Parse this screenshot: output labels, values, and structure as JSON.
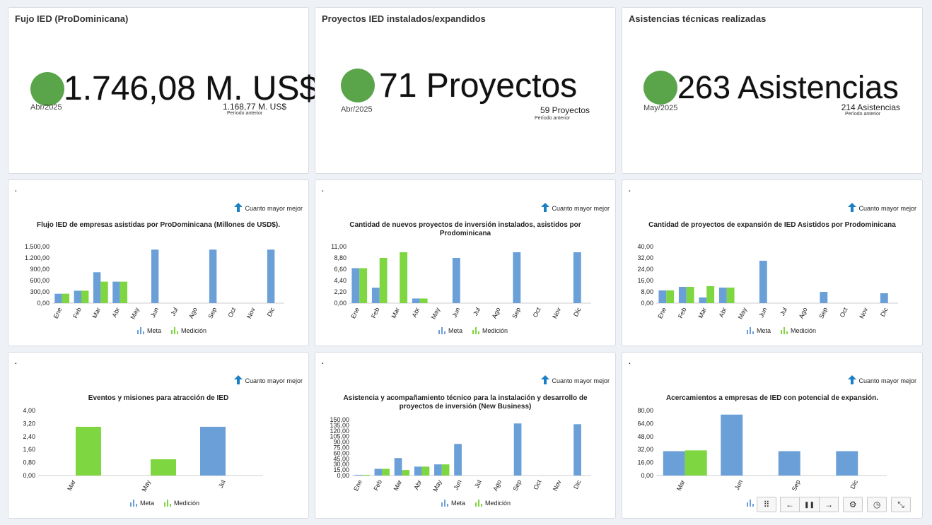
{
  "kpis": [
    {
      "title": "Fujo IED (ProDominicana)",
      "value": "1.746,08 M. US$",
      "date": "Abr/2025",
      "prev": "1.168,77 M. US$",
      "prev_label": "Período anterior",
      "color": "#5aa44a"
    },
    {
      "title": "Proyectos IED instalados/expandidos",
      "value": "71 Proyectos",
      "date": "Abr/2025",
      "prev": "59 Proyectos",
      "prev_label": "Período anterior",
      "color": "#5aa44a"
    },
    {
      "title": "Asistencias técnicas realizadas",
      "value": "263 Asistencias",
      "date": "May/2025",
      "prev": "214 Asistencias",
      "prev_label": "Período anterior",
      "color": "#5aa44a"
    }
  ],
  "common": {
    "dot": ".",
    "better": "Cuanto mayor mejor",
    "legend_meta": "Meta",
    "legend_medicion": "Medición",
    "colors": {
      "meta": "#6a9fd8",
      "medicion": "#7ed640",
      "up_arrow": "#1b7fc4"
    }
  },
  "chart_data": [
    {
      "type": "bar",
      "title": "Flujo IED de empresas asistidas por ProDominicana (Millones de USD$).",
      "categories": [
        "Ene",
        "Feb",
        "Mar",
        "Abr",
        "May",
        "Jun",
        "Jul",
        "Ago",
        "Sep",
        "Oct",
        "Nov",
        "Dic"
      ],
      "yticks": [
        "0,00",
        "300,00",
        "600,00",
        "900,00",
        "1.200,00",
        "1.500,00"
      ],
      "ylim": [
        0,
        1500
      ],
      "series": [
        {
          "name": "Meta",
          "values": [
            250,
            330,
            820,
            570,
            null,
            1420,
            null,
            null,
            1420,
            null,
            null,
            1420
          ]
        },
        {
          "name": "Medición",
          "values": [
            250,
            330,
            570,
            570,
            null,
            null,
            null,
            null,
            null,
            null,
            null,
            null
          ]
        }
      ]
    },
    {
      "type": "bar",
      "title": "Cantidad de nuevos proyectos de inversión instalados, asistidos por Prodominicana",
      "categories": [
        "Ene",
        "Feb",
        "Mar",
        "Abr",
        "May",
        "Jun",
        "Jul",
        "Ago",
        "Sep",
        "Oct",
        "Nov",
        "Dic"
      ],
      "yticks": [
        "0,00",
        "2,20",
        "4,40",
        "6,60",
        "8,80",
        "11,00"
      ],
      "ylim": [
        0,
        11
      ],
      "series": [
        {
          "name": "Meta",
          "values": [
            6.8,
            3,
            null,
            0.9,
            null,
            8.8,
            null,
            null,
            9.9,
            null,
            null,
            9.9
          ]
        },
        {
          "name": "Medición",
          "values": [
            6.8,
            8.8,
            9.9,
            0.9,
            null,
            null,
            null,
            null,
            null,
            null,
            null,
            null
          ]
        }
      ]
    },
    {
      "type": "bar",
      "title": "Cantidad de proyectos de expansión de IED Asistidos por Prodominicana",
      "categories": [
        "Ene",
        "Feb",
        "Mar",
        "Abr",
        "May",
        "Jun",
        "Jul",
        "Ago",
        "Sep",
        "Oct",
        "Nov",
        "Dic"
      ],
      "yticks": [
        "0,00",
        "8,00",
        "16,00",
        "24,00",
        "32,00",
        "40,00"
      ],
      "ylim": [
        0,
        40
      ],
      "series": [
        {
          "name": "Meta",
          "values": [
            9,
            11.5,
            4,
            11,
            null,
            30,
            null,
            null,
            8,
            null,
            null,
            7
          ]
        },
        {
          "name": "Medición",
          "values": [
            9,
            11.5,
            12,
            11,
            null,
            null,
            null,
            null,
            null,
            null,
            null,
            null
          ]
        }
      ]
    },
    {
      "type": "bar",
      "title": "Eventos y misiones para atracción de IED",
      "categories": [
        "Mar",
        "May",
        "Jul"
      ],
      "yticks": [
        "0,00",
        "0,80",
        "1,60",
        "2,40",
        "3,20",
        "4,00"
      ],
      "ylim": [
        0,
        4
      ],
      "series": [
        {
          "name": "Meta",
          "values": [
            null,
            null,
            3
          ]
        },
        {
          "name": "Medición",
          "values": [
            3,
            1,
            null
          ]
        }
      ]
    },
    {
      "type": "bar",
      "title": "Asistencia y acompañamiento técnico para la instalación y desarrollo de proyectos de inversión (New Business)",
      "categories": [
        "Ene",
        "Feb",
        "Mar",
        "Abr",
        "May",
        "Jun",
        "Jul",
        "Ago",
        "Sep",
        "Oct",
        "Nov",
        "Dic"
      ],
      "yticks": [
        "0,00",
        "15,00",
        "30,00",
        "45,00",
        "60,00",
        "75,00",
        "90,00",
        "105,00",
        "120,00",
        "135,00",
        "150,00"
      ],
      "ylim": [
        0,
        150
      ],
      "series": [
        {
          "name": "Meta",
          "values": [
            2,
            18,
            47,
            24,
            30,
            85,
            null,
            null,
            140,
            null,
            null,
            138
          ]
        },
        {
          "name": "Medición",
          "values": [
            2,
            18,
            15,
            24,
            30,
            null,
            null,
            null,
            null,
            null,
            null,
            null
          ]
        }
      ]
    },
    {
      "type": "bar",
      "title": "Acercamientos a empresas de IED con potencial de expansión.",
      "categories": [
        "Mar",
        "Jun",
        "Sep",
        "Dic"
      ],
      "yticks": [
        "0,00",
        "16,00",
        "32,00",
        "48,00",
        "64,00",
        "80,00"
      ],
      "ylim": [
        0,
        80
      ],
      "series": [
        {
          "name": "Meta",
          "values": [
            30,
            75,
            30,
            30
          ]
        },
        {
          "name": "Medición",
          "values": [
            31,
            null,
            null,
            null
          ]
        }
      ]
    }
  ],
  "controls": {
    "grip": "⠿",
    "prev": "←",
    "pause": "❚❚",
    "next": "→",
    "settings": "⚙",
    "timer": "◷",
    "collapse": "⤡"
  }
}
